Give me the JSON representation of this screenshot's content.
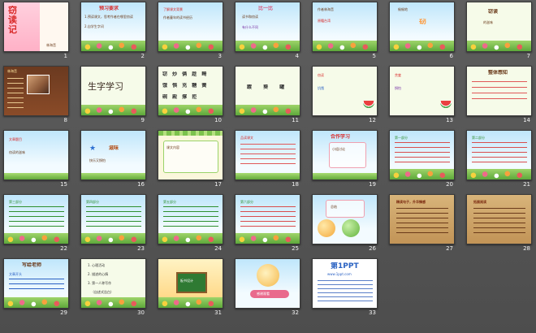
{
  "slides": [
    {
      "num": "1",
      "title": "窃读记",
      "author": "林海音"
    },
    {
      "num": "2",
      "title": "预习要求",
      "l1": "1.预读课文，思考作者在哪里窃读",
      "l2": "2.自学生字词"
    },
    {
      "num": "3",
      "l1": "了解课文背景",
      "l2": "作者童年的读书经历"
    },
    {
      "num": "4",
      "title": "比一比",
      "l1": "读书和窃读",
      "l2": "有什么不同"
    },
    {
      "num": "5",
      "l1": "作者林海音",
      "l2": "原籍台湾"
    },
    {
      "num": "6",
      "l1": "窃",
      "l2": "偷偷地"
    },
    {
      "num": "7",
      "l1": "窃读",
      "l2": "的滋味"
    },
    {
      "num": "8",
      "title": "林海音"
    },
    {
      "num": "9",
      "title": "生字学习"
    },
    {
      "num": "10",
      "r1": "窃 炒 俩 趁 畸",
      "r2": "饿 惧 充 糖 簧",
      "r3": "碗 殿 撑 拒"
    },
    {
      "num": "11",
      "r1": "踱 葵 罐"
    },
    {
      "num": "12",
      "l1": "窃读",
      "l2": "饥饿"
    },
    {
      "num": "13",
      "l1": "贪婪",
      "l2": "惧怕"
    },
    {
      "num": "14",
      "title": "整体感知"
    },
    {
      "num": "15",
      "l1": "文章题目",
      "l2": "窃读的滋味"
    },
    {
      "num": "16",
      "title": "滋味",
      "l1": "快乐又惧怕"
    },
    {
      "num": "17",
      "l1": "课文内容"
    },
    {
      "num": "18",
      "l1": "品读课文"
    },
    {
      "num": "19",
      "title": "合作学习",
      "l1": "小组讨论"
    },
    {
      "num": "20",
      "l1": "第一部分"
    },
    {
      "num": "21",
      "l1": "第二部分"
    },
    {
      "num": "22",
      "l1": "第三部分"
    },
    {
      "num": "23",
      "l1": "第四部分"
    },
    {
      "num": "24",
      "l1": "第五部分"
    },
    {
      "num": "25",
      "l1": "第六部分"
    },
    {
      "num": "26",
      "l1": "总结"
    },
    {
      "num": "27",
      "title": "精读句子，升华情感"
    },
    {
      "num": "28",
      "l1": "拓展阅读"
    },
    {
      "num": "29",
      "title": "写给老师",
      "l1": "文章开头"
    },
    {
      "num": "30",
      "l1": "1. 心理活动",
      "l2": "2. 描述的心情",
      "l3": "3. 第一人称写作",
      "l4": "（自述式告白）"
    },
    {
      "num": "31",
      "l1": "板书设计"
    },
    {
      "num": "32",
      "title": "感谢观看"
    },
    {
      "num": "33",
      "title": "第1PPT",
      "l1": "www.1ppt.com"
    }
  ],
  "colors": {
    "background": "#555555",
    "accent": "#ff86a3"
  }
}
